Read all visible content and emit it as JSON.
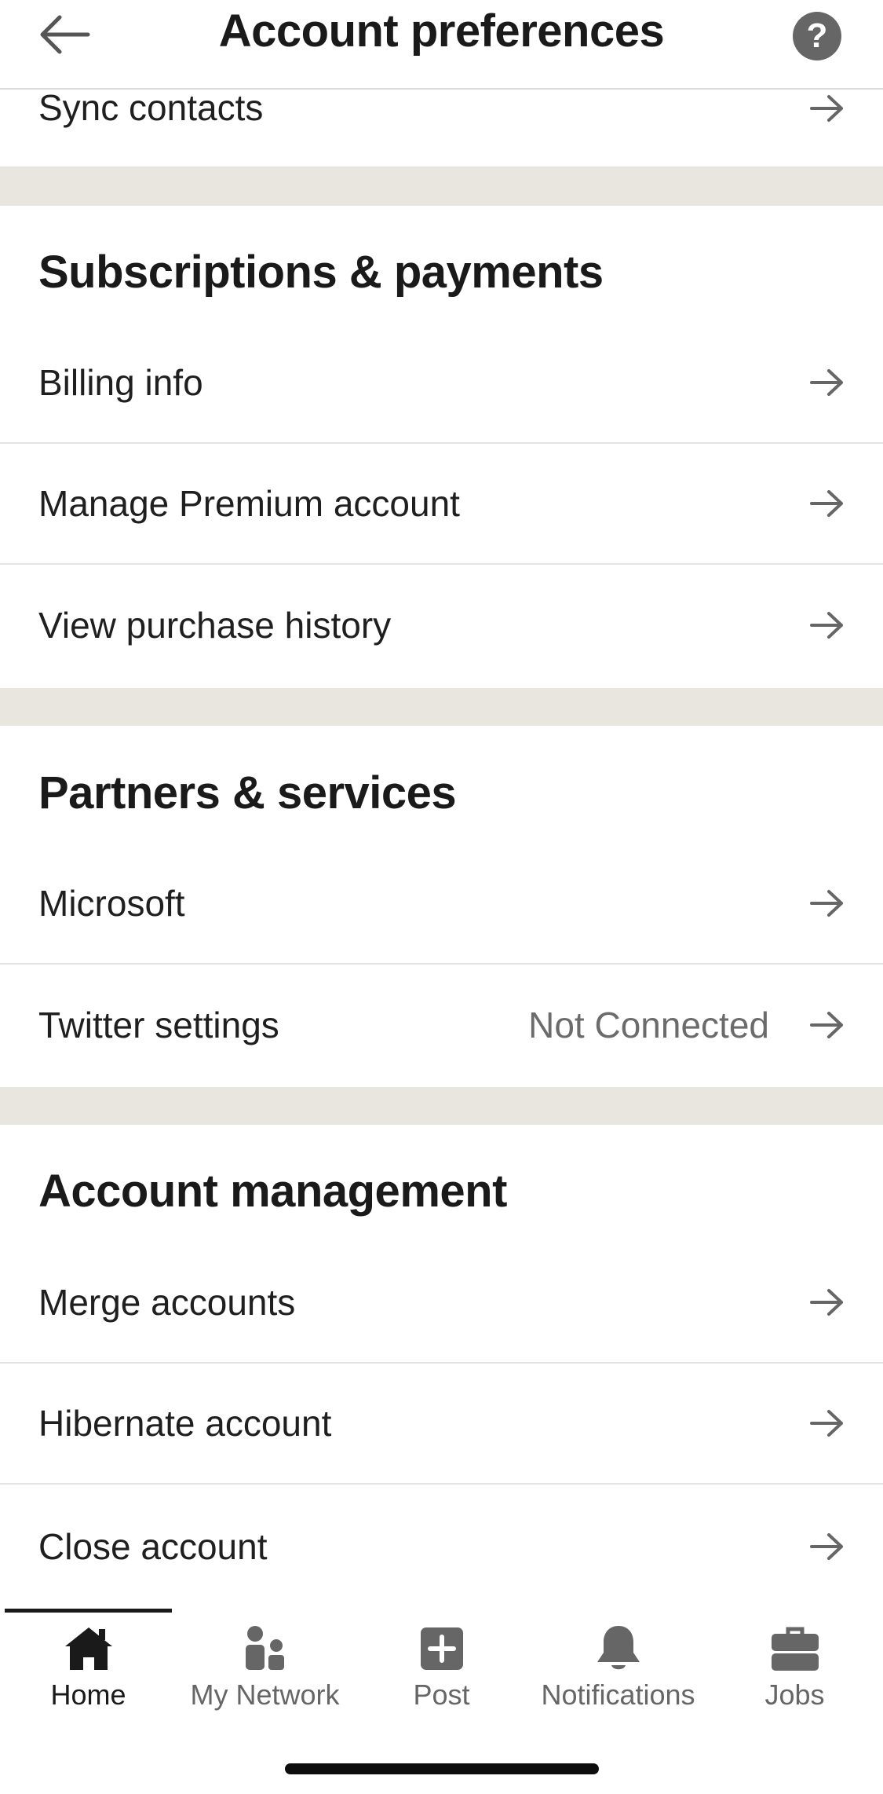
{
  "header": {
    "title": "Account preferences",
    "help_icon": "question-circle-icon",
    "back_icon": "arrow-left-icon"
  },
  "top_rows": [
    {
      "label": "Sync contacts"
    }
  ],
  "sections": [
    {
      "title": "Subscriptions & payments",
      "rows": [
        {
          "label": "Billing info"
        },
        {
          "label": "Manage Premium account"
        },
        {
          "label": "View purchase history"
        }
      ]
    },
    {
      "title": "Partners & services",
      "rows": [
        {
          "label": "Microsoft"
        },
        {
          "label": "Twitter settings",
          "value": "Not Connected"
        }
      ]
    },
    {
      "title": "Account management",
      "rows": [
        {
          "label": "Merge accounts"
        },
        {
          "label": "Hibernate account"
        },
        {
          "label": "Close account"
        }
      ]
    }
  ],
  "tabs": [
    {
      "label": "Home",
      "icon": "home-icon",
      "active": true
    },
    {
      "label": "My Network",
      "icon": "network-icon",
      "active": false
    },
    {
      "label": "Post",
      "icon": "plus-square-icon",
      "active": false
    },
    {
      "label": "Notifications",
      "icon": "bell-icon",
      "active": false
    },
    {
      "label": "Jobs",
      "icon": "briefcase-icon",
      "active": false
    }
  ],
  "colors": {
    "section_divider": "#e9e6df",
    "arrow": "#666666",
    "active_tab": "#1a1a1a",
    "inactive_tab": "#666666"
  }
}
